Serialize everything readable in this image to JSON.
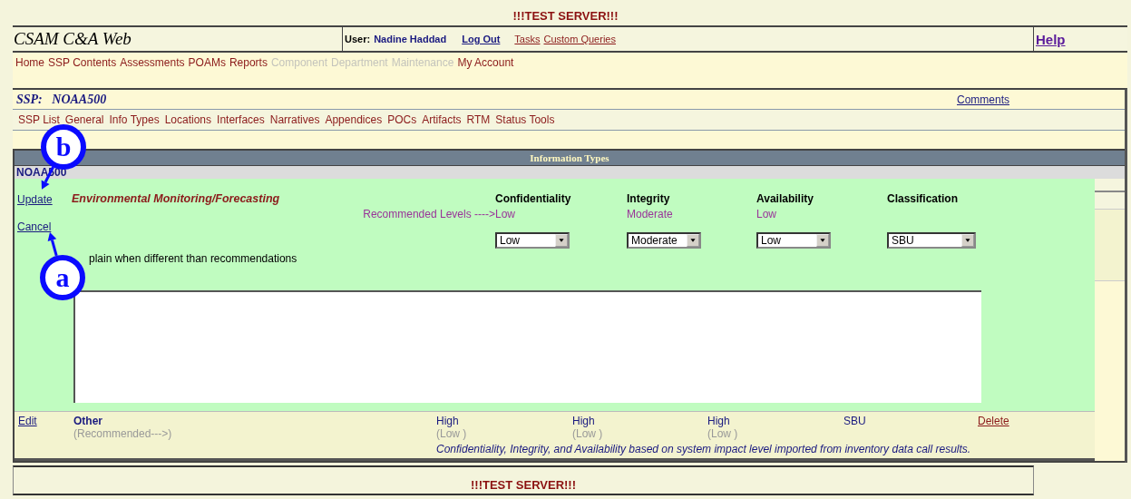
{
  "banner_top": "!!!TEST SERVER!!!",
  "header": {
    "app_title": "CSAM C&A Web",
    "user_label": "User:",
    "user_name": "Nadine Haddad",
    "links": [
      "Log Out",
      "Tasks",
      "Custom Queries"
    ],
    "help": "Help"
  },
  "main_nav": [
    {
      "label": "Home",
      "disabled": false
    },
    {
      "label": "SSP Contents",
      "disabled": false
    },
    {
      "label": "Assessments",
      "disabled": false
    },
    {
      "label": "POAMs",
      "disabled": false
    },
    {
      "label": "Reports",
      "disabled": false
    },
    {
      "label": "Component",
      "disabled": true
    },
    {
      "label": "Department",
      "disabled": true
    },
    {
      "label": "Maintenance",
      "disabled": true
    },
    {
      "label": "My Account",
      "disabled": false
    }
  ],
  "ssp": {
    "label": "SSP:",
    "name": "NOAA500",
    "comments": "Comments",
    "tabs": [
      "SSP List",
      "General",
      "Info Types",
      "Locations",
      "Interfaces",
      "Narratives",
      "Appendices",
      "POCs",
      "Artifacts",
      "RTM",
      "Status Tools"
    ]
  },
  "info_types": {
    "header": "Information Types",
    "system": "NOAA500",
    "edit": {
      "actions": [
        "Update",
        "Cancel"
      ],
      "name": "Environmental Monitoring/Forecasting",
      "recommended_label": "Recommended Levels ---->",
      "columns": [
        {
          "header": "Confidentiality",
          "recommended": "Low",
          "value": "Low"
        },
        {
          "header": "Integrity",
          "recommended": "Moderate",
          "value": "Moderate"
        },
        {
          "header": "Availability",
          "recommended": "Low",
          "value": "Low"
        },
        {
          "header": "Classification",
          "value": "SBU"
        }
      ],
      "explain_label": "plain when different than recommendations"
    },
    "rows": [
      {
        "action": "Edit",
        "name": "Other",
        "recommended_label": "(Recommended--->)",
        "levels": [
          {
            "value": "High",
            "recommended": "(Low )"
          },
          {
            "value": "High",
            "recommended": "(Low )"
          },
          {
            "value": "High",
            "recommended": "(Low )"
          }
        ],
        "classification": "SBU",
        "delete": "Delete",
        "note": "Confidentiality, Integrity, and Availability based on system impact level imported from inventory data call results."
      }
    ]
  },
  "banner_bottom": "!!!TEST SERVER!!!",
  "callouts": [
    {
      "label": "b"
    },
    {
      "label": "a"
    }
  ]
}
